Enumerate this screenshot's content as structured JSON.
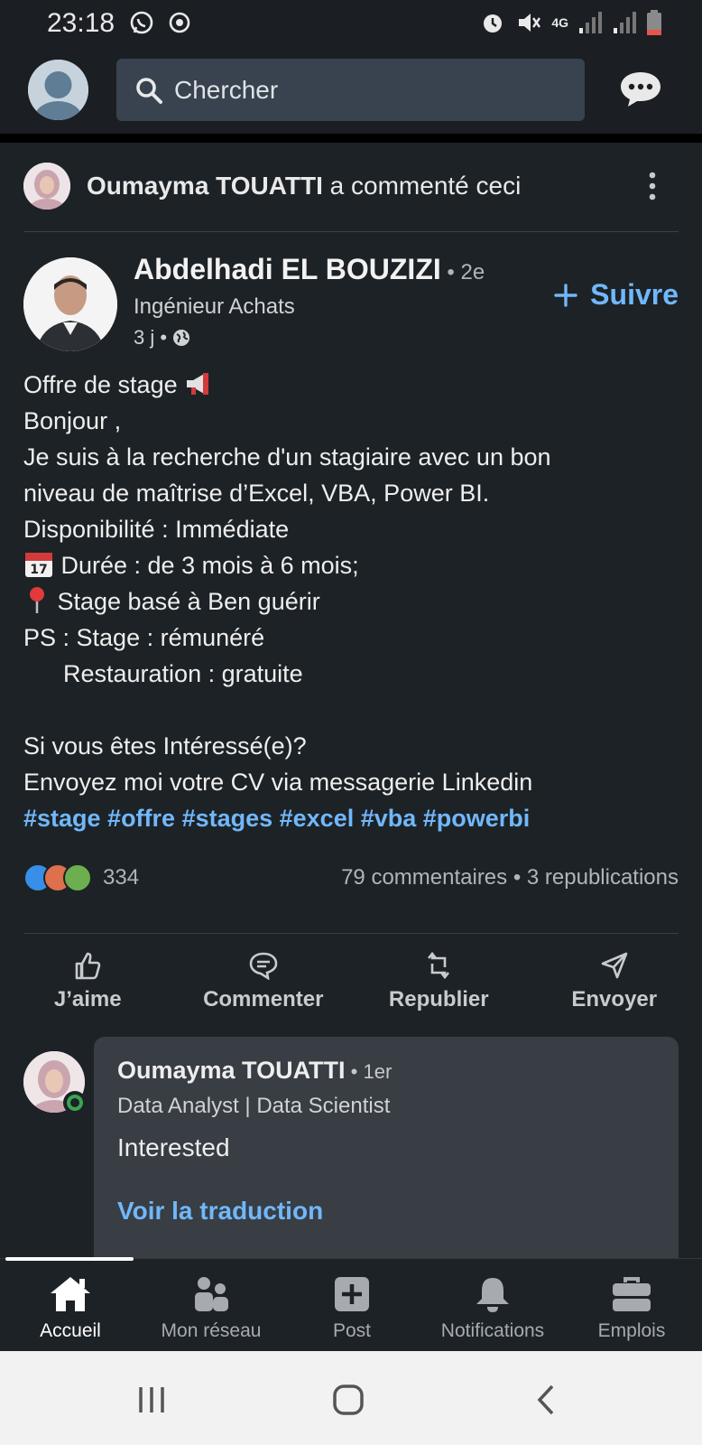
{
  "status_bar": {
    "time": "23:18",
    "network": "4G"
  },
  "search": {
    "placeholder": "Chercher"
  },
  "context": {
    "name": "Oumayma TOUATTI",
    "action": " a commenté ceci"
  },
  "author": {
    "name": "Abdelhadi EL BOUZIZI",
    "degree": " • 2e",
    "title": "Ingénieur Achats",
    "time": "3 j •",
    "follow_label": "Suivre"
  },
  "post": {
    "l1": "Offre de stage",
    "l2": "Bonjour ,",
    "l3": "Je suis à la recherche d'un stagiaire avec un bon",
    "l4": "niveau de maîtrise d’Excel, VBA, Power BI.",
    "l5": "Disponibilité : Immédiate",
    "l6": " Durée : de 3 mois à 6 mois;",
    "l7": " Stage basé à Ben guérir",
    "l8": "PS : Stage : rémunéré",
    "l9": "Restauration : gratuite",
    "l10": "Si vous êtes Intéressé(e)?",
    "l11": "Envoyez moi votre CV via messagerie Linkedin",
    "hashtags": "#stage #offre #stages #excel #vba #powerbi"
  },
  "social": {
    "reactions": "334",
    "counts": "79 commentaires • 3 republications"
  },
  "actions": {
    "like": "J’aime",
    "comment": "Commenter",
    "repost": "Republier",
    "send": "Envoyer"
  },
  "comment": {
    "name": "Oumayma TOUATTI",
    "degree": " • 1er",
    "title": "Data Analyst | Data Scientist",
    "text": "Interested",
    "translate": "Voir la traduction"
  },
  "nav": {
    "home": "Accueil",
    "network": "Mon réseau",
    "post": "Post",
    "notifications": "Notifications",
    "jobs": "Emplois"
  },
  "colors": {
    "background": "#1b1f23",
    "card": "#1d2226",
    "accent": "#71b7fb",
    "comment_bubble": "#383e43"
  }
}
